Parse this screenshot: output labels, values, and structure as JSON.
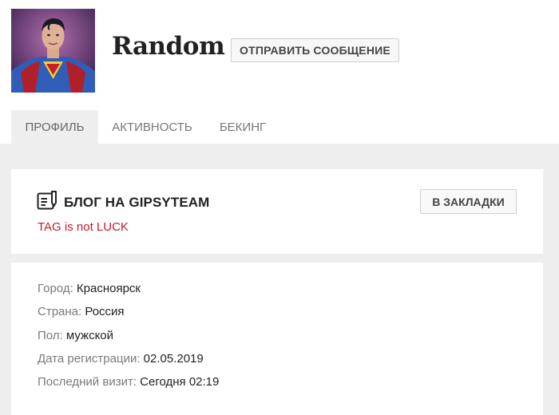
{
  "profile": {
    "username": "Random",
    "send_message_label": "ОТПРАВИТЬ СООБЩЕНИЕ"
  },
  "tabs": [
    {
      "label": "ПРОФИЛЬ",
      "active": true
    },
    {
      "label": "АКТИВНОСТЬ",
      "active": false
    },
    {
      "label": "БЕКИНГ",
      "active": false
    }
  ],
  "blog": {
    "icon": "blog-document-icon",
    "title": "БЛОГ НА GIPSYTEAM",
    "tagline": "TAG is not LUCK",
    "bookmark_label": "В ЗАКЛАДКИ"
  },
  "info": [
    {
      "label": "Город:",
      "value": "Красноярск"
    },
    {
      "label": "Страна:",
      "value": "Россия"
    },
    {
      "label": "Пол:",
      "value": "мужской"
    },
    {
      "label": "Дата регистрации:",
      "value": "02.05.2019"
    },
    {
      "label": "Последний визит:",
      "value": "Сегодня 02:19"
    }
  ],
  "colors": {
    "accent_red": "#c51a2a",
    "page_background": "#eeeeee"
  }
}
